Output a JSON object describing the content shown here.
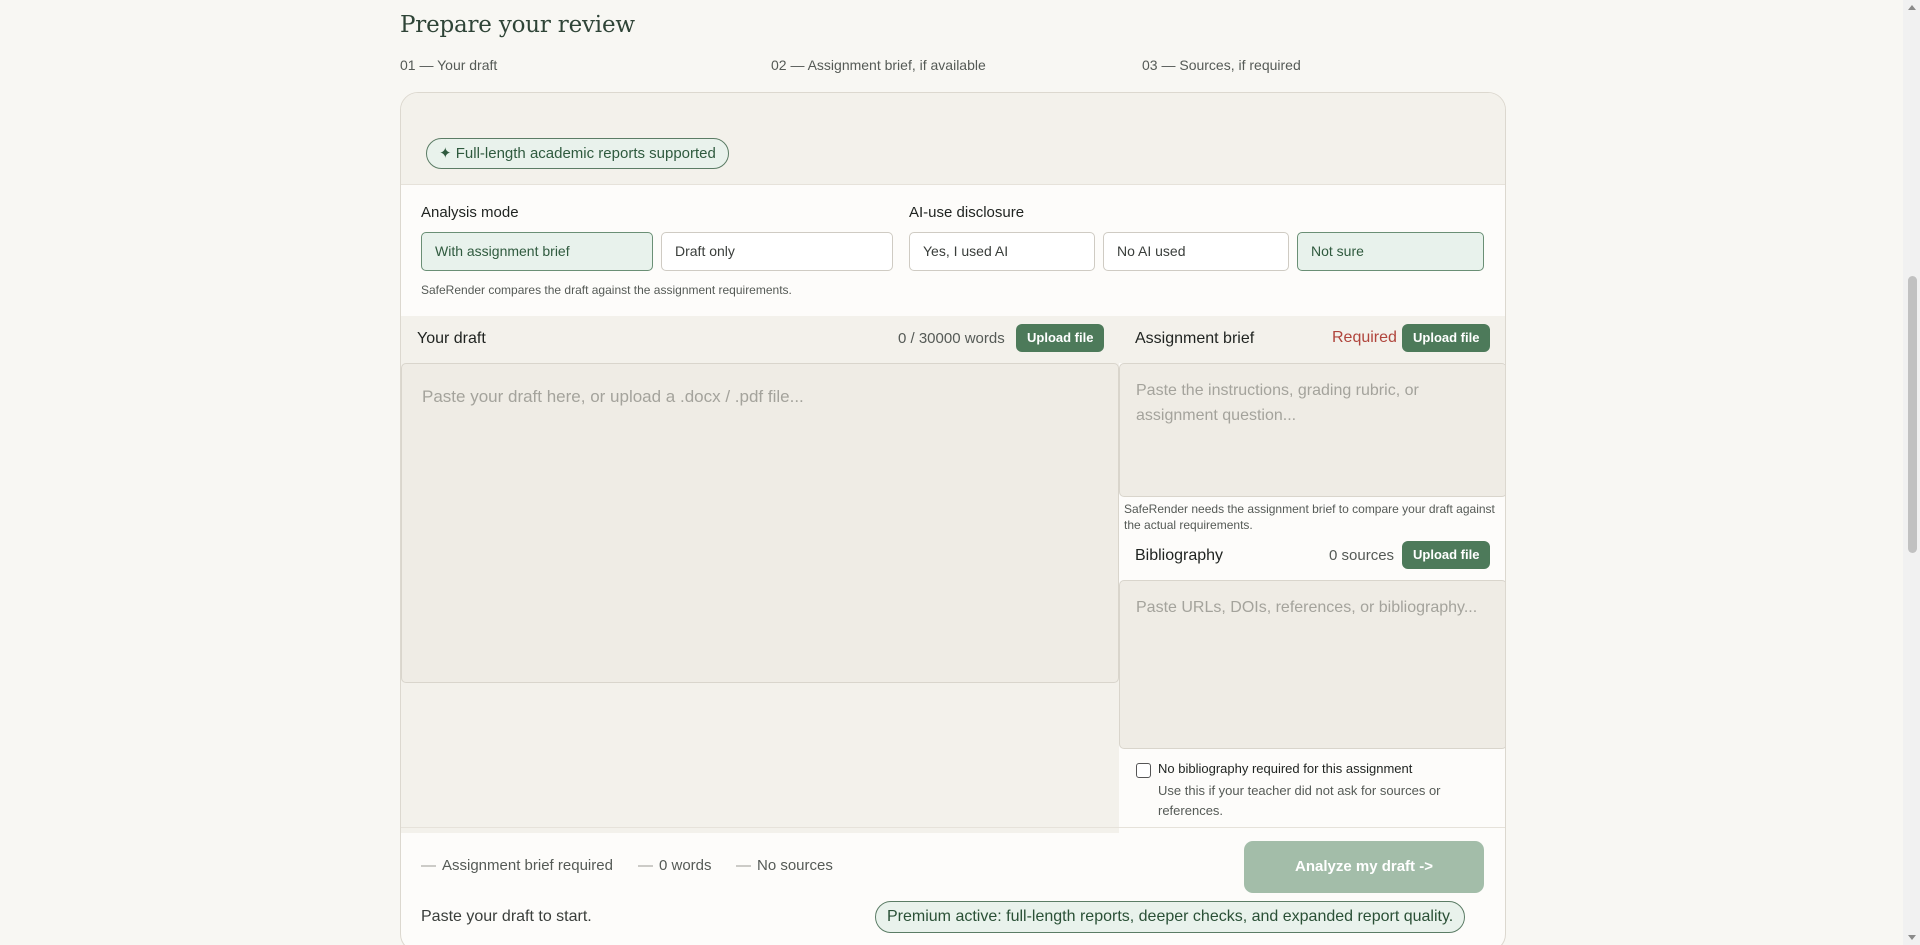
{
  "page": {
    "title": "Prepare your review",
    "steps": [
      "01 — Your draft",
      "02 — Assignment brief, if available",
      "03 — Sources, if required"
    ]
  },
  "banner": {
    "pill": "✦ Full-length academic reports supported"
  },
  "analysis_mode": {
    "label": "Analysis mode",
    "options": [
      "With assignment brief",
      "Draft only"
    ],
    "selected": "With assignment brief",
    "hint": "SafeRender compares the draft against the assignment requirements."
  },
  "ai_disclosure": {
    "label": "AI-use disclosure",
    "options": [
      "Yes, I used AI",
      "No AI used",
      "Not sure"
    ],
    "selected": "Not sure"
  },
  "draft": {
    "title": "Your draft",
    "word_count": "0 / 30000 words",
    "upload_label": "Upload file",
    "placeholder": "Paste your draft here, or upload a .docx / .pdf file..."
  },
  "brief": {
    "title": "Assignment brief",
    "required_label": "Required",
    "upload_label": "Upload file",
    "placeholder": "Paste the instructions, grading rubric, or assignment question...",
    "hint": "SafeRender needs the assignment brief to compare your draft against the actual requirements."
  },
  "bibliography": {
    "title": "Bibliography",
    "count": "0 sources",
    "upload_label": "Upload file",
    "placeholder": "Paste URLs, DOIs, references, or bibliography...",
    "checkbox_label": "No bibliography required for this assignment",
    "checkbox_hint": "Use this if your teacher did not ask for sources or references.",
    "checkbox_checked": false
  },
  "footer": {
    "dash": "—",
    "stats": [
      "Assignment brief required",
      "0 words",
      "No sources"
    ],
    "analyze_label": "Analyze my draft ->",
    "status": "Paste your draft to start.",
    "premium": "Premium active: full-length reports, deeper checks, and expanded report quality."
  },
  "colors": {
    "accent": "#4d7a5a",
    "required": "#b0453c",
    "background": "#f8f7f3"
  }
}
